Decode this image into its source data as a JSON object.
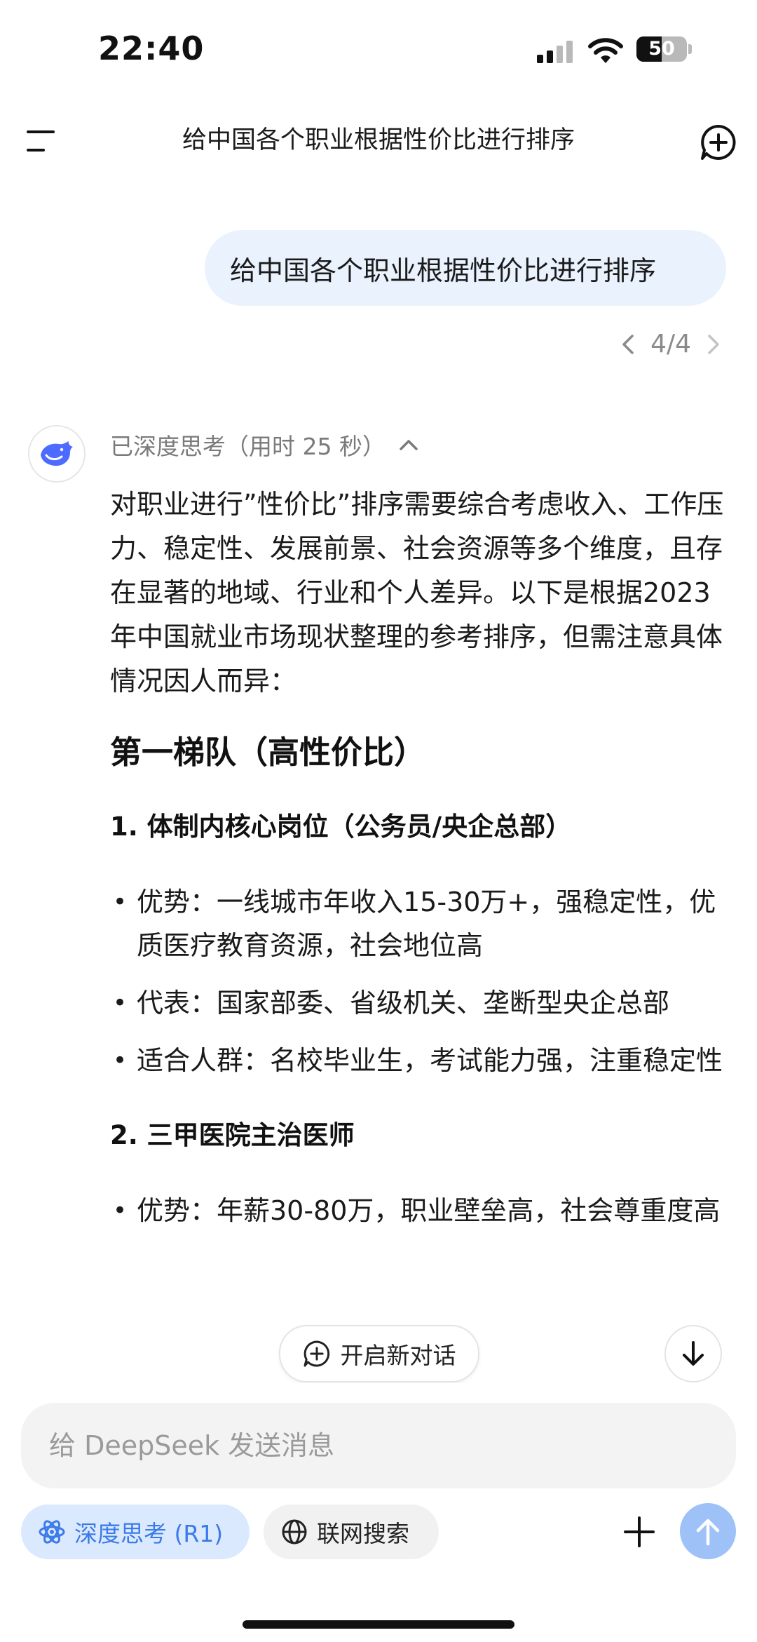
{
  "status_bar": {
    "time": "22:40",
    "battery": "50"
  },
  "header": {
    "title": "给中国各个职业根据性价比进行排序"
  },
  "user_message": {
    "text": "给中国各个职业根据性价比进行排序",
    "pager": "4/4"
  },
  "assistant": {
    "thinking_label": "已深度思考（用时 25 秒）",
    "intro": "对职业进行”性价比”排序需要综合考虑收入、工作压力、稳定性、发展前景、社会资源等多个维度，且存在显著的地域、行业和个人差异。以下是根据2023年中国就业市场现状整理的参考排序，但需注意具体情况因人而异：",
    "tier1_heading": "第一梯队（高性价比）",
    "item1": {
      "heading": "1. 体制内核心岗位（公务员/央企总部）",
      "bullets": [
        "优势：一线城市年收入15-30万+，强稳定性，优质医疗教育资源，社会地位高",
        "代表：国家部委、省级机关、垄断型央企总部",
        "适合人群：名校毕业生，考试能力强，注重稳定性"
      ]
    },
    "item2": {
      "heading": "2. 三甲医院主治医师",
      "bullets": [
        "优势：年薪30-80万，职业壁垒高，社会尊重度高"
      ]
    }
  },
  "floating": {
    "new_chat_label": "开启新对话"
  },
  "composer": {
    "placeholder": "给 DeepSeek 发送消息",
    "deepthink_label": "深度思考 (R1)",
    "search_label": "联网搜索"
  },
  "colors": {
    "accent": "#3b7ae8",
    "bubble": "#eaf2fe",
    "send": "#9ec1f7"
  }
}
